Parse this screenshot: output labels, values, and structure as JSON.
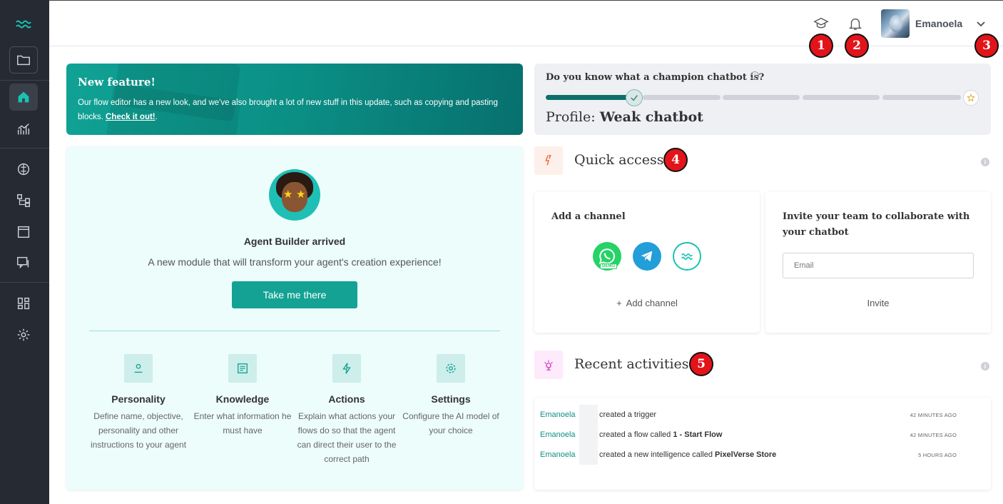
{
  "sidebar": {
    "logo": "waves-logo-icon",
    "items": [
      {
        "icon": "folder-icon"
      },
      {
        "icon": "home-icon"
      },
      {
        "icon": "analytics-icon"
      },
      {
        "icon": "brain-icon"
      },
      {
        "icon": "flow-icon"
      },
      {
        "icon": "window-icon"
      },
      {
        "icon": "chat-icon"
      },
      {
        "icon": "dashboard-icon"
      },
      {
        "icon": "gear-icon"
      }
    ]
  },
  "topbar": {
    "username": "Emanoela",
    "badges": [
      "1",
      "2",
      "3"
    ]
  },
  "banner": {
    "title": "New feature!",
    "text": "Our flow editor has a new look, and we've also brought a lot of new stuff in this update, such as copying and pasting blocks.",
    "link": "Check it out!",
    "suffix": "."
  },
  "champion": {
    "question": "Do you know what a champion chatbot is?",
    "profile_label": "Profile:",
    "profile_value": "Weak chatbot",
    "progress_step": 1,
    "progress_total": 5
  },
  "agent": {
    "heading": "Agent Builder arrived",
    "subtitle": "A new module that will transform your agent's creation experience!",
    "button": "Take me there",
    "features": [
      {
        "icon": "person-icon",
        "title": "Personality",
        "desc": "Define name, objective, personality and other instructions to your agent"
      },
      {
        "icon": "document-icon",
        "title": "Knowledge",
        "desc": "Enter what information he must have"
      },
      {
        "icon": "bolt-icon",
        "title": "Actions",
        "desc": "Explain what actions your flows do so that the agent can direct their user to the correct path"
      },
      {
        "icon": "gear-icon",
        "title": "Settings",
        "desc": "Configure the AI model of your choice"
      }
    ]
  },
  "quick_access": {
    "title": "Quick access",
    "badge": "4",
    "add_channel": {
      "title": "Add a channel",
      "channels": [
        "whatsapp-demo-icon",
        "telegram-icon",
        "webchat-icon"
      ],
      "action": "Add channel"
    },
    "invite": {
      "title": "Invite your team to collaborate with your chatbot",
      "placeholder": "Email",
      "action": "Invite"
    }
  },
  "recent": {
    "title": "Recent activities",
    "badge": "5",
    "rows": [
      {
        "user": "Emanoela",
        "text": "created a trigger",
        "bold": "",
        "time": "42 MINUTES AGO"
      },
      {
        "user": "Emanoela",
        "text": "created a flow called ",
        "bold": "1 - Start Flow",
        "time": "42 MINUTES AGO"
      },
      {
        "user": "Emanoela",
        "text": "created a new intelligence called ",
        "bold": "PixelVerse Store",
        "time": "5 HOURS AGO"
      }
    ]
  },
  "colors": {
    "accent": "#13a293",
    "sidebar": "#262a33",
    "badge": "#e3131a",
    "link": "#0f8f85"
  }
}
